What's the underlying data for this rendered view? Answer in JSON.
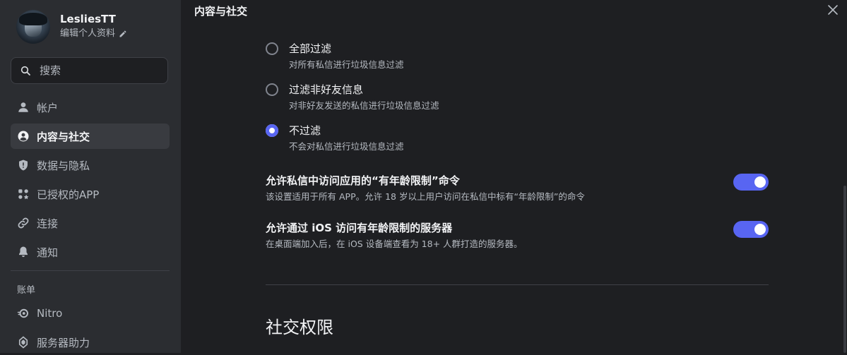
{
  "profile": {
    "username": "LesliesTT",
    "edit_label": "编辑个人资料"
  },
  "search": {
    "placeholder": "搜索"
  },
  "sidebar": {
    "items": [
      {
        "label": "帐户",
        "icon": "user-icon"
      },
      {
        "label": "内容与社交",
        "icon": "user-circle-icon",
        "active": true
      },
      {
        "label": "数据与隐私",
        "icon": "shield-icon"
      },
      {
        "label": "已授权的APP",
        "icon": "apps-icon"
      },
      {
        "label": "连接",
        "icon": "link-icon"
      },
      {
        "label": "通知",
        "icon": "bell-icon"
      }
    ],
    "billing_section": {
      "title": "账单",
      "items": [
        {
          "label": "Nitro",
          "icon": "nitro-icon"
        },
        {
          "label": "服务器助力",
          "icon": "boost-icon"
        }
      ]
    }
  },
  "main": {
    "header": "内容与社交",
    "dm_filter": {
      "options": [
        {
          "title": "全部过滤",
          "desc": "对所有私信进行垃圾信息过滤",
          "selected": false
        },
        {
          "title": "过滤非好友信息",
          "desc": "对非好友发送的私信进行垃圾信息过滤",
          "selected": false
        },
        {
          "title": "不过滤",
          "desc": "不会对私信进行垃圾信息过滤",
          "selected": true
        }
      ]
    },
    "toggles": [
      {
        "title": "允许私信中访问应用的“有年龄限制”命令",
        "desc": "该设置适用于所有 APP。允许 18 岁以上用户访问在私信中标有“年龄限制”的命令",
        "on": true
      },
      {
        "title": "允许通过 iOS 访问有年龄限制的服务器",
        "desc": "在桌面端加入后，在 iOS 设备端查看为 18+ 人群打造的服务器。",
        "on": true
      }
    ],
    "social_section_title": "社交权限"
  },
  "colors": {
    "accent": "#5865f2",
    "background": "#1e1f22",
    "sidebar": "#2b2d31",
    "active_item": "#393b40"
  }
}
